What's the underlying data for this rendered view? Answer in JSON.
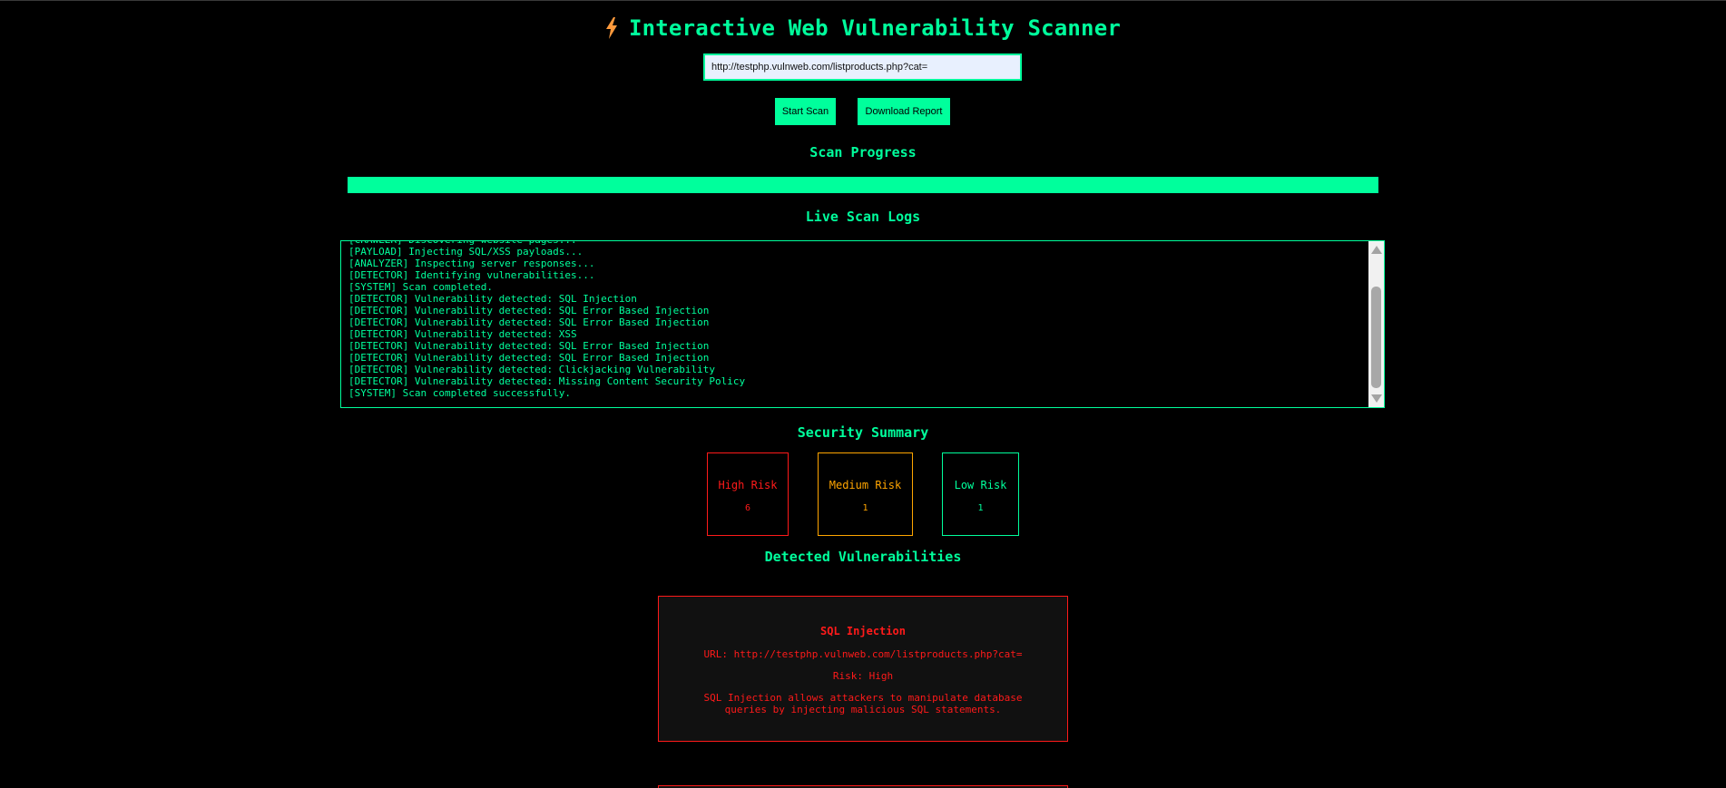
{
  "header": {
    "icon": "lightning-bolt-icon",
    "title": "Interactive Web Vulnerability Scanner"
  },
  "scan_form": {
    "url_value": "http://testphp.vulnweb.com/listproducts.php?cat=",
    "start_label": "Start Scan",
    "download_label": "Download Report"
  },
  "progress": {
    "heading": "Scan Progress",
    "percent": 100
  },
  "logs": {
    "heading": "Live Scan Logs",
    "lines": [
      "[CRAWLER] Discovering website pages...",
      "[PAYLOAD] Injecting SQL/XSS payloads...",
      "[ANALYZER] Inspecting server responses...",
      "[DETECTOR] Identifying vulnerabilities...",
      "[SYSTEM] Scan completed.",
      "[DETECTOR] Vulnerability detected: SQL Injection",
      "[DETECTOR] Vulnerability detected: SQL Error Based Injection",
      "[DETECTOR] Vulnerability detected: SQL Error Based Injection",
      "[DETECTOR] Vulnerability detected: XSS",
      "[DETECTOR] Vulnerability detected: SQL Error Based Injection",
      "[DETECTOR] Vulnerability detected: SQL Error Based Injection",
      "[DETECTOR] Vulnerability detected: Clickjacking Vulnerability",
      "[DETECTOR] Vulnerability detected: Missing Content Security Policy",
      "[SYSTEM] Scan completed successfully."
    ]
  },
  "summary": {
    "heading": "Security Summary",
    "high": {
      "label": "High Risk",
      "count": "6"
    },
    "medium": {
      "label": "Medium Risk",
      "count": "1"
    },
    "low": {
      "label": "Low Risk",
      "count": "1"
    }
  },
  "vulnerabilities": {
    "heading": "Detected Vulnerabilities",
    "items": [
      {
        "title": "SQL Injection",
        "url_label": "URL:",
        "url": "http://testphp.vulnweb.com/listproducts.php?cat=",
        "risk_label": "Risk:",
        "risk": "High",
        "description": "SQL Injection allows attackers to manipulate database queries by injecting malicious SQL statements."
      }
    ]
  },
  "colors": {
    "accent": "#00ff9c",
    "high": "#ff1a1a",
    "medium": "#ffa500",
    "low": "#00ff9c",
    "bolt": "#ff9a3c"
  }
}
